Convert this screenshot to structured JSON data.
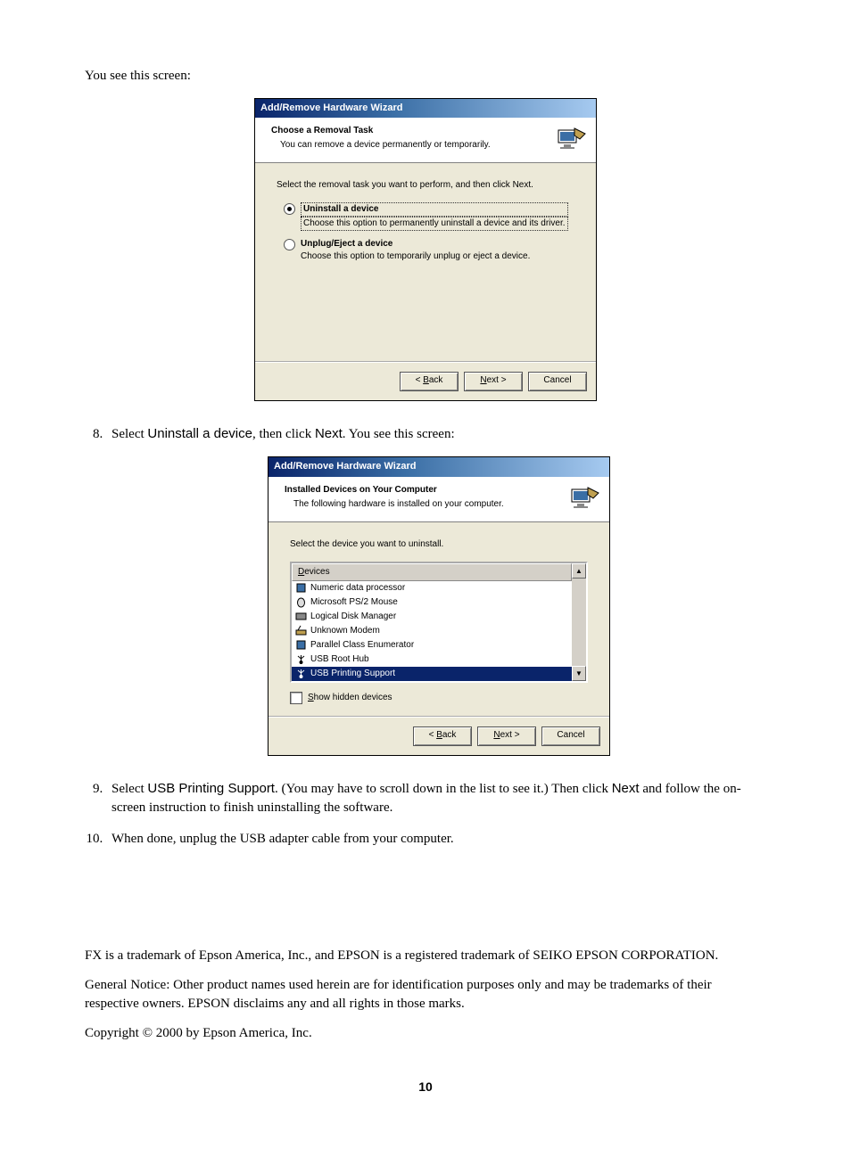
{
  "intro": "You see this screen:",
  "wizard1": {
    "title": "Add/Remove Hardware Wizard",
    "header_title": "Choose a Removal Task",
    "header_sub": "You can remove a device permanently or temporarily.",
    "instr": "Select the removal task you want to perform, and then click Next.",
    "opt1_label": "Uninstall a device",
    "opt1_desc": "Choose this option to permanently uninstall a device and its driver.",
    "opt2_label": "Unplug/Eject a device",
    "opt2_desc": "Choose this option to temporarily unplug or eject a device.",
    "btn_back": "< Back",
    "btn_next": "Next >",
    "btn_cancel": "Cancel"
  },
  "step8_pre": "Select ",
  "step8_bold1": "Uninstall a device",
  "step8_mid": ", then click ",
  "step8_bold2": "Next",
  "step8_post": ". You see this screen:",
  "wizard2": {
    "title": "Add/Remove Hardware Wizard",
    "header_title": "Installed Devices on Your Computer",
    "header_sub": "The following hardware is installed on your computer.",
    "instr": "Select the device you want to uninstall.",
    "col_header": "Devices",
    "items": [
      "Numeric data processor",
      "Microsoft PS/2 Mouse",
      "Logical Disk Manager",
      "Unknown Modem",
      "Parallel Class Enumerator",
      "USB Root Hub",
      "USB Printing Support"
    ],
    "show_hidden": "Show hidden devices",
    "btn_back": "< Back",
    "btn_next": "Next >",
    "btn_cancel": "Cancel"
  },
  "step9_pre": "Select ",
  "step9_bold1": "USB Printing Support",
  "step9_mid1": ". (You may have to scroll down in the list to see it.) Then click ",
  "step9_bold2": "Next",
  "step9_post": " and follow the on-screen instruction to finish uninstalling the software.",
  "step10": "When done, unplug the USB adapter cable from your computer.",
  "footer1": "FX is a trademark of Epson America, Inc., and EPSON is a registered trademark of SEIKO EPSON CORPORATION.",
  "footer2": "General Notice: Other product names used herein are for identification purposes only and may be trademarks of their respective owners. EPSON disclaims any and all rights in those marks.",
  "footer3": "Copyright © 2000 by Epson America, Inc.",
  "page_num": "10"
}
